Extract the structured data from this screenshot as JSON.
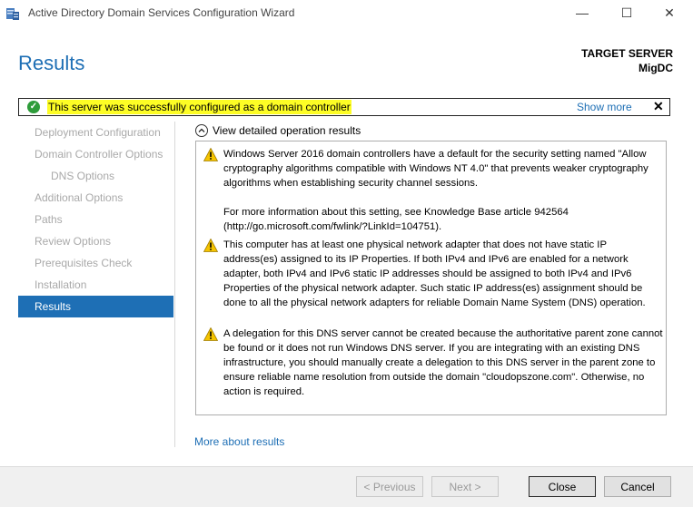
{
  "window": {
    "title": "Active Directory Domain Services Configuration Wizard",
    "icon": "server-wizard-icon",
    "controls": {
      "minimize": "—",
      "maximize": "☐",
      "close": "✕"
    }
  },
  "header": {
    "page_title": "Results",
    "target_label": "TARGET SERVER",
    "target_name": "MigDC"
  },
  "banner": {
    "status": "success",
    "message": "This server was successfully configured as a domain controller",
    "show_more": "Show more",
    "close": "✕",
    "highlight_color": "#fdfd25"
  },
  "nav": {
    "items": [
      {
        "label": "Deployment Configuration",
        "state": "disabled"
      },
      {
        "label": "Domain Controller Options",
        "state": "disabled"
      },
      {
        "label": "DNS Options",
        "state": "disabled"
      },
      {
        "label": "Additional Options",
        "state": "disabled"
      },
      {
        "label": "Paths",
        "state": "disabled"
      },
      {
        "label": "Review Options",
        "state": "disabled"
      },
      {
        "label": "Prerequisites Check",
        "state": "disabled"
      },
      {
        "label": "Installation",
        "state": "disabled"
      },
      {
        "label": "Results",
        "state": "active"
      }
    ]
  },
  "details": {
    "toggle_label": "View detailed operation results",
    "messages": [
      {
        "icon": "warning-icon",
        "paragraphs": [
          "Windows Server 2016 domain controllers have a default for the security setting named \"Allow cryptography algorithms compatible with Windows NT 4.0\" that prevents weaker cryptography algorithms when establishing security channel sessions.",
          "For more information about this setting, see Knowledge Base article 942564 (http://go.microsoft.com/fwlink/?LinkId=104751)."
        ]
      },
      {
        "icon": "warning-icon",
        "paragraphs": [
          "This computer has at least one physical network adapter that does not have static IP address(es) assigned to its IP Properties. If both IPv4 and IPv6 are enabled for a network adapter, both IPv4 and IPv6 static IP addresses should be assigned to both IPv4 and IPv6 Properties of the physical network adapter. Such static IP address(es) assignment should be done to all the physical network adapters for reliable Domain Name System (DNS) operation."
        ]
      },
      {
        "icon": "warning-icon",
        "paragraphs": [
          "A delegation for this DNS server cannot be created because the authoritative parent zone cannot be found or it does not run Windows DNS server. If you are integrating with an existing DNS infrastructure, you should manually create a delegation to this DNS server in the parent zone to ensure reliable name resolution from outside the domain \"cloudopszone.com\". Otherwise, no action is required."
        ]
      }
    ]
  },
  "more_results": "More about results",
  "footer": {
    "previous": "< Previous",
    "next": "Next >",
    "close": "Close",
    "cancel": "Cancel"
  },
  "colors": {
    "accent": "#1e6fb5",
    "success": "#2e9c3a",
    "warning": "#f5c400"
  }
}
